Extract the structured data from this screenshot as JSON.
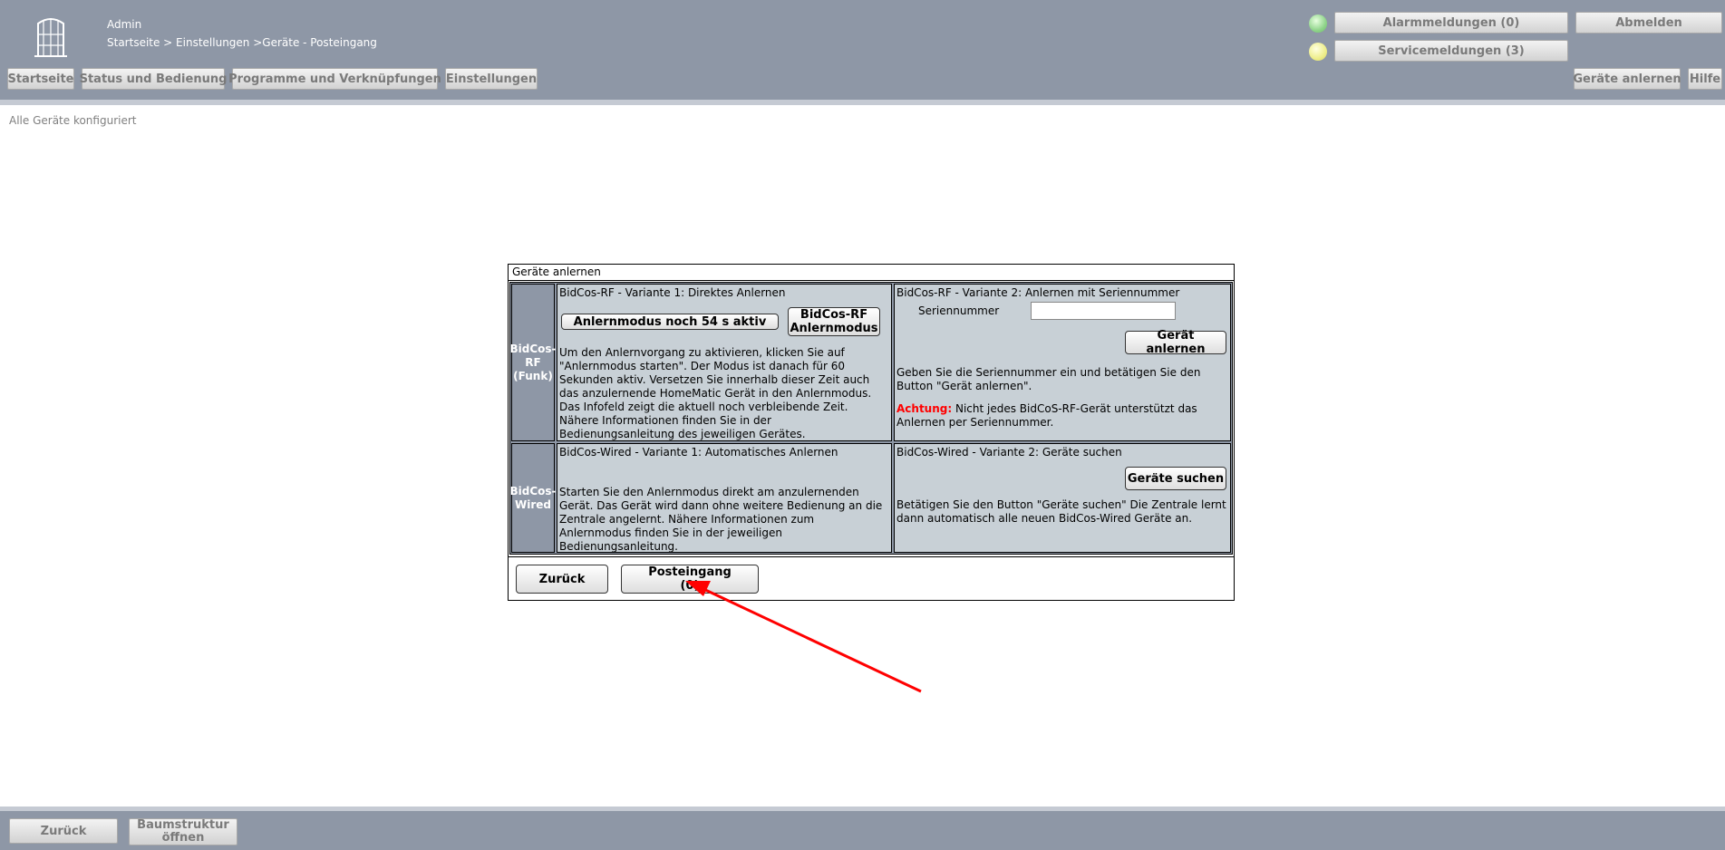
{
  "header": {
    "user": "Admin",
    "breadcrumb": "Startseite > Einstellungen >Geräte - Posteingang",
    "nav": {
      "home": "Startseite",
      "status": "Status und Bedienung",
      "programs": "Programme und Verknüpfungen",
      "settings": "Einstellungen"
    },
    "alarm_label": "Alarmmeldungen (0)",
    "service_label": "Servicemeldungen (3)",
    "logout_label": "Abmelden",
    "teach_devices_label": "Geräte anlernen",
    "help_label": "Hilfe",
    "colors": {
      "alarm_led": "#8fd48a",
      "service_led": "#eeee8a",
      "header_bg": "#8e97a6"
    }
  },
  "main": {
    "status_text": "Alle Geräte konfiguriert"
  },
  "dialog": {
    "title": "Geräte anlernen",
    "rf": {
      "row_label_1": "BidCos-",
      "row_label_2": "RF",
      "row_label_3": "(Funk)",
      "v1": {
        "title": "BidCos-RF - Variante 1: Direktes Anlernen",
        "mode_button": "Anlernmodus noch 54 s aktiv",
        "rf_button_line1": "BidCos-RF",
        "rf_button_line2": "Anlernmodus",
        "description": "Um den Anlernvorgang zu aktivieren, klicken Sie auf \"Anlernmodus starten\". Der Modus ist danach für 60 Sekunden aktiv. Versetzen Sie innerhalb dieser Zeit auch das anzulernende HomeMatic Gerät in den Anlernmodus. Das Infofeld zeigt die aktuell noch verbleibende Zeit. Nähere Informationen finden Sie in der Bedienungsanleitung des jeweiligen Gerätes."
      },
      "v2": {
        "title": "BidCos-RF - Variante 2: Anlernen mit Seriennummer",
        "serial_label": "Seriennummer",
        "serial_value": "",
        "teach_button": "Gerät anlernen",
        "description": "Geben Sie die Seriennummer ein und betätigen Sie den Button \"Gerät anlernen\".",
        "warning_label": "Achtung:",
        "warning_text": " Nicht jedes BidCoS-RF-Gerät unterstützt das Anlernen per Seriennummer."
      }
    },
    "wired": {
      "row_label_1": "BidCos-",
      "row_label_2": "Wired",
      "v1": {
        "title": "BidCos-Wired - Variante 1: Automatisches Anlernen",
        "description": "Starten Sie den Anlernmodus direkt am anzulernenden Gerät. Das Gerät wird dann ohne weitere Bedienung an die Zentrale angelernt. Nähere Informationen zum Anlernmodus finden Sie in der jeweiligen Bedienungsanleitung."
      },
      "v2": {
        "title": "BidCos-Wired - Variante 2: Geräte suchen",
        "search_button": "Geräte suchen",
        "description": "Betätigen Sie den Button \"Geräte suchen\" Die Zentrale lernt dann automatisch alle neuen BidCos-Wired Geräte an."
      }
    },
    "back_button": "Zurück",
    "inbox_button_line1": "Posteingang",
    "inbox_button_line2": "(0)"
  },
  "footer": {
    "back_button": "Zurück",
    "tree_button_line1": "Baumstruktur",
    "tree_button_line2": "öffnen"
  },
  "annotation": {
    "arrow_color": "#ff0000"
  }
}
